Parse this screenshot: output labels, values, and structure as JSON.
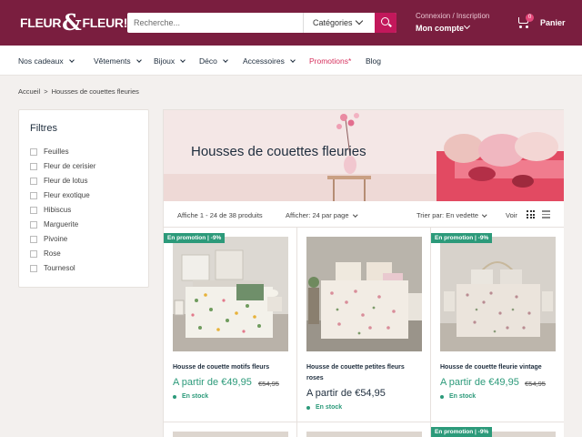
{
  "header": {
    "logo_text_1": "FLEUR",
    "logo_amp": "&",
    "logo_text_2": "FLEUR!",
    "search_placeholder": "Recherche...",
    "category_label": "Catégories",
    "account_line1": "Connexion / Inscription",
    "account_line2": "Mon compte",
    "cart_count": "0",
    "cart_label": "Panier"
  },
  "nav": {
    "items": [
      {
        "label": "Nos cadeaux",
        "has_dropdown": true
      },
      {
        "label": "Vêtements",
        "has_dropdown": true
      },
      {
        "label": "Bijoux",
        "has_dropdown": true
      },
      {
        "label": "Déco",
        "has_dropdown": true
      },
      {
        "label": "Accessoires",
        "has_dropdown": true
      },
      {
        "label": "Promotions*",
        "has_dropdown": false
      },
      {
        "label": "Blog",
        "has_dropdown": false
      }
    ]
  },
  "breadcrumb": {
    "home": "Accueil",
    "sep": ">",
    "current": "Housses de couettes fleuries"
  },
  "filters": {
    "title": "Filtres",
    "options": [
      "Feuilles",
      "Fleur de cerisier",
      "Fleur de lotus",
      "Fleur exotique",
      "Hibiscus",
      "Marguerite",
      "Pivoine",
      "Rose",
      "Tournesol"
    ]
  },
  "collection": {
    "title": "Housses de couettes fleuries",
    "count_text": "Affiche 1 - 24 de 38 produits",
    "per_page": "Afficher: 24 par page",
    "sort": "Trier par: En vedette",
    "view_label": "Voir"
  },
  "products": [
    {
      "badge": "En promotion | -9%",
      "name": "Housse de couette motifs fleurs",
      "price": "A partir de €49,95",
      "old_price": "€54,95",
      "stock": "En stock"
    },
    {
      "badge": "",
      "name": "Housse de couette petites fleurs roses",
      "price": "A partir de €54,95",
      "old_price": "",
      "stock": "En stock"
    },
    {
      "badge": "En promotion | -9%",
      "name": "Housse de couette fleurie vintage",
      "price": "A partir de €49,95",
      "old_price": "€54,95",
      "stock": "En stock"
    }
  ],
  "next_row_badge": "En promotion | -9%",
  "colors": {
    "brand": "#7a1e3f",
    "accent": "#c2185b",
    "promo": "#2c9a7a"
  }
}
